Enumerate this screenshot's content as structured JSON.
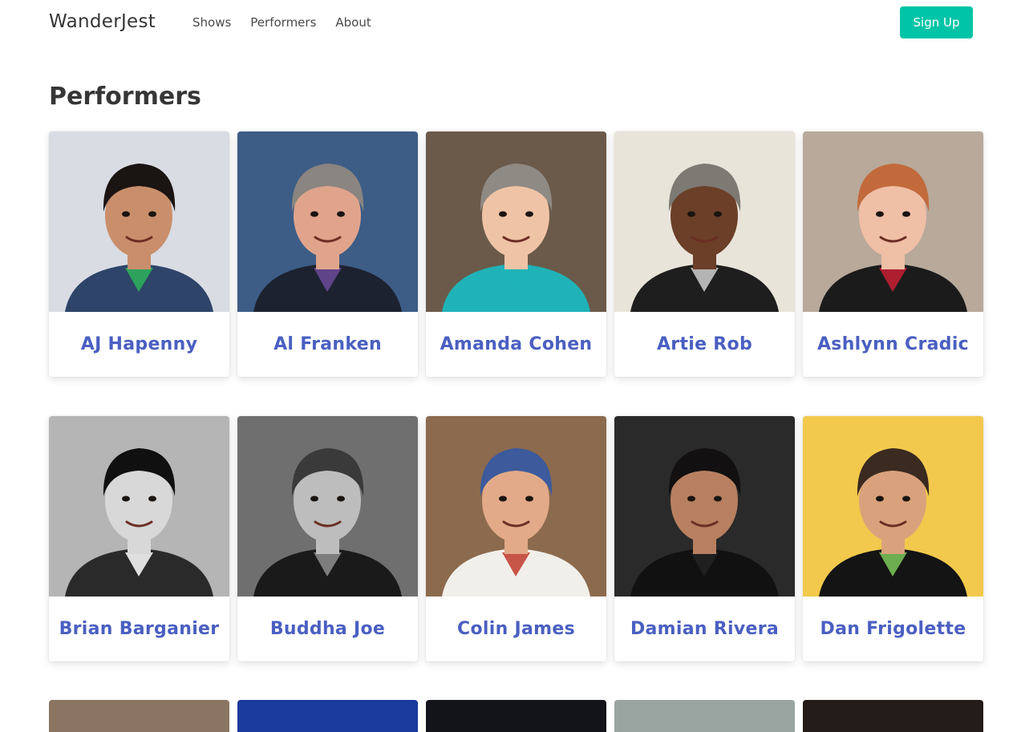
{
  "nav": {
    "brand": "WanderJest",
    "links": [
      "Shows",
      "Performers",
      "About"
    ],
    "signup_label": "Sign Up"
  },
  "page": {
    "title": "Performers"
  },
  "performers": [
    {
      "name": "AJ Hapenny",
      "bg": "#d9dce3",
      "skin": "#c98f6c",
      "hair": "#1a1412",
      "shirt": "#2e4468",
      "accent": "#2bb35a"
    },
    {
      "name": "Al Franken",
      "bg": "#3d5d86",
      "skin": "#e0a48c",
      "hair": "#8a8580",
      "shirt": "#1d2230",
      "accent": "#6b4a9a"
    },
    {
      "name": "Amanda Cohen",
      "bg": "#6b5a4a",
      "skin": "#efc3a6",
      "hair": "#8f8a84",
      "shirt": "#1fb3b8",
      "accent": "#1fb3b8"
    },
    {
      "name": "Artie Rob",
      "bg": "#e9e4d9",
      "skin": "#6b3f28",
      "hair": "#7d7a74",
      "shirt": "#1e1e1e",
      "accent": "#cfcfcf"
    },
    {
      "name": "Ashlynn Cradic",
      "bg": "#b8a99a",
      "skin": "#efbfa6",
      "hair": "#c26a3c",
      "shirt": "#1b1b1b",
      "accent": "#c81e32"
    },
    {
      "name": "Brian Barganier",
      "bg": "#b5b5b5",
      "skin": "#d8d8d8",
      "hair": "#101010",
      "shirt": "#2a2a2a",
      "accent": "#ffffff"
    },
    {
      "name": "Buddha Joe",
      "bg": "#6f6f6f",
      "skin": "#bdbdbd",
      "hair": "#3a3a3a",
      "shirt": "#1a1a1a",
      "accent": "#8f8f8f"
    },
    {
      "name": "Colin James",
      "bg": "#8c6a4e",
      "skin": "#e2aa88",
      "hair": "#3c5a9c",
      "shirt": "#f1efe9",
      "accent": "#c0392b"
    },
    {
      "name": "Damian Rivera",
      "bg": "#2a2a2a",
      "skin": "#b88060",
      "hair": "#121010",
      "shirt": "#111111",
      "accent": "#222222"
    },
    {
      "name": "Dan Frigolette",
      "bg": "#f2c94c",
      "skin": "#d9a27c",
      "hair": "#3a2a20",
      "shirt": "#141414",
      "accent": "#7bc95a"
    }
  ],
  "partial_row_colors": [
    "#8a7563",
    "#1a3a9e",
    "#12141a",
    "#9aa4a0",
    "#241c18"
  ]
}
